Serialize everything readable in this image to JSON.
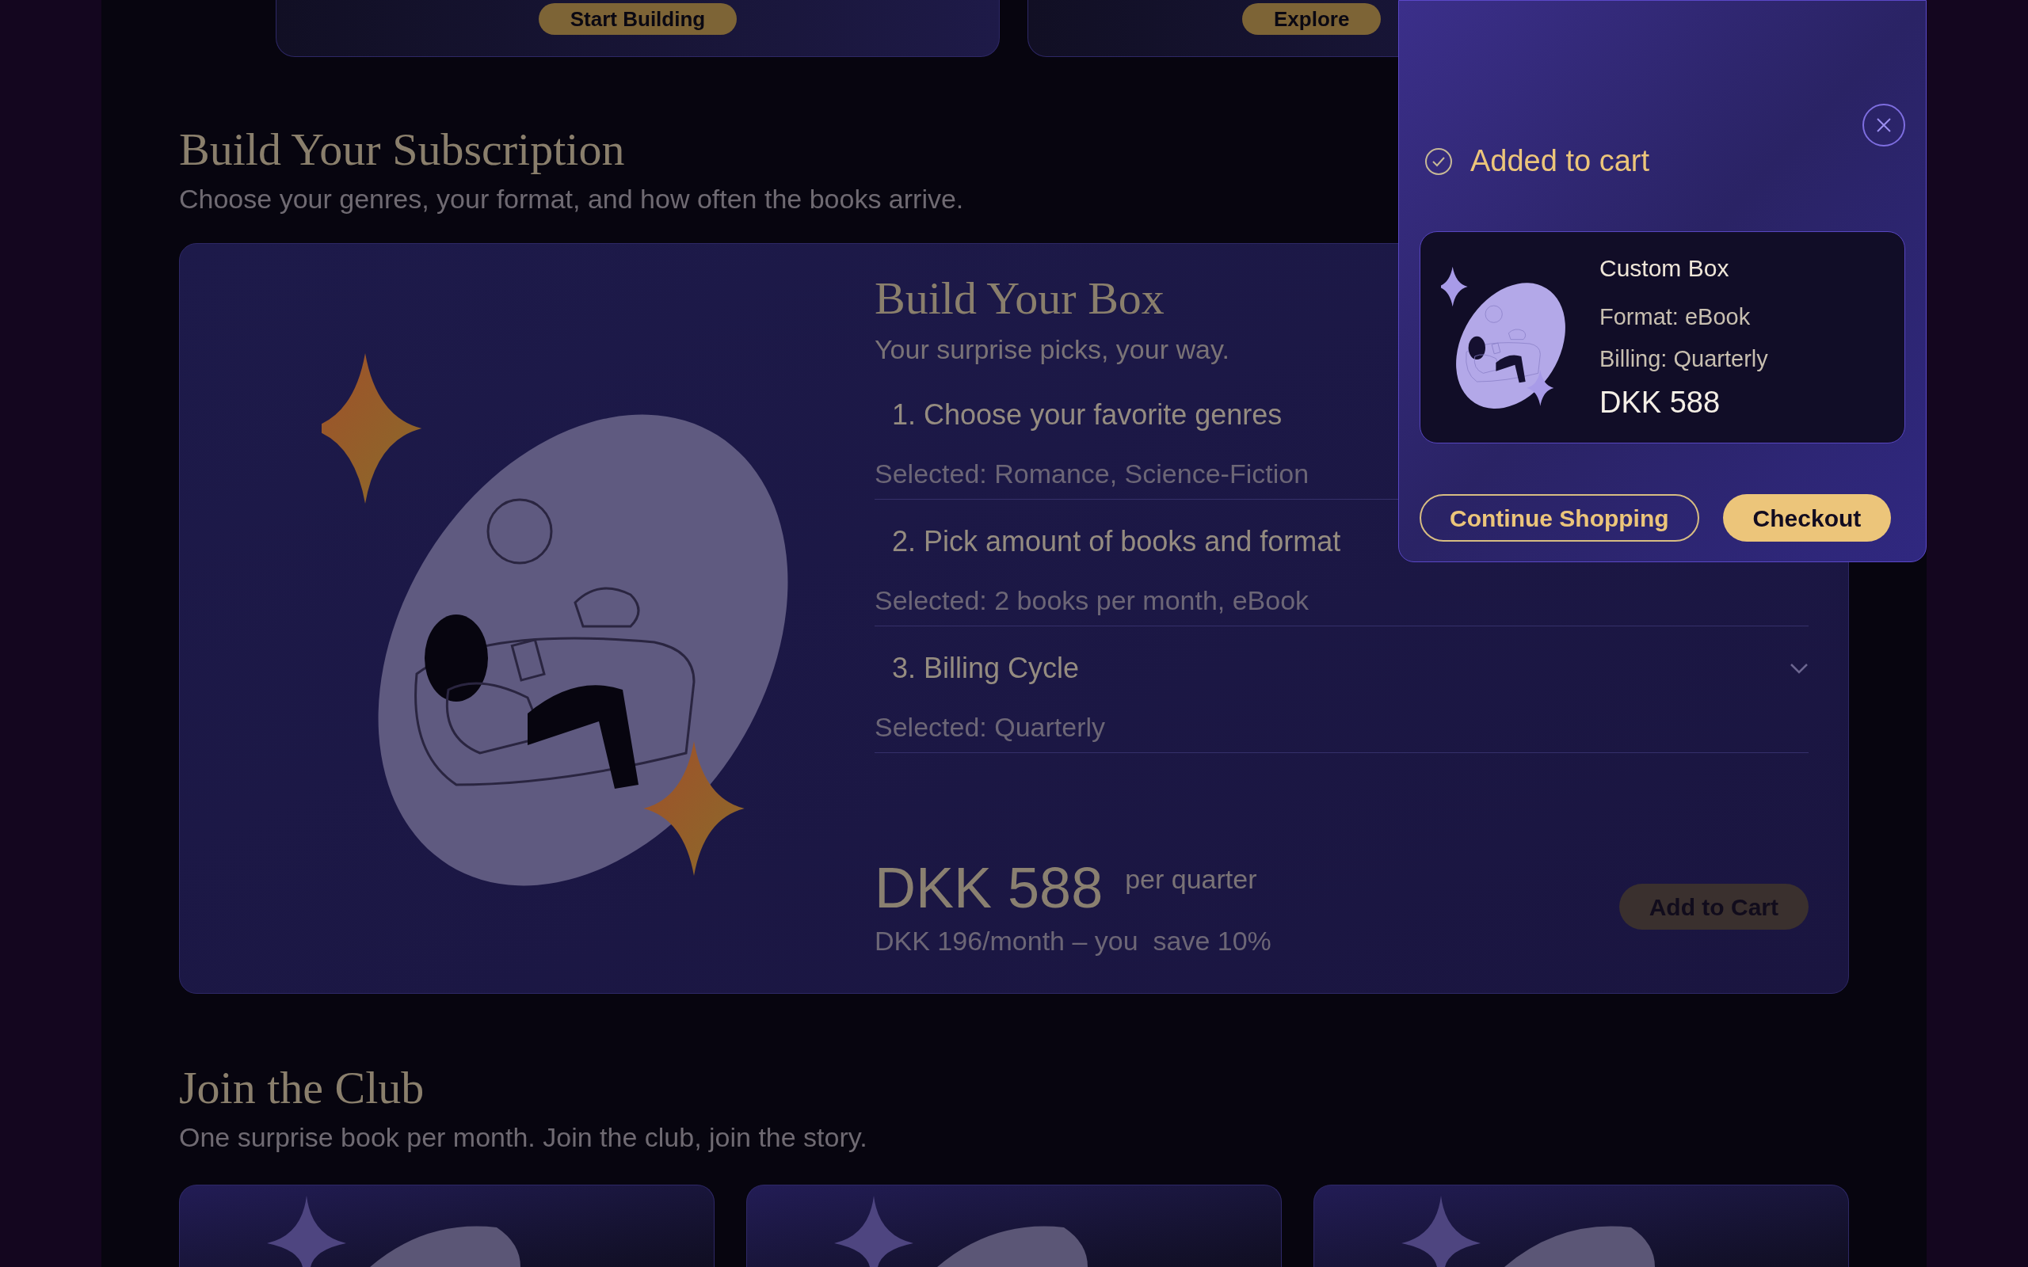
{
  "top_cards": [
    {
      "button": "Start Building"
    },
    {
      "button": "Explore"
    }
  ],
  "subscription": {
    "title": "Build Your Subscription",
    "subtitle": "Choose your genres, your format, and how often the books arrive.",
    "box": {
      "title": "Build Your Box",
      "subtitle": "Your surprise picks, your way.",
      "steps": [
        {
          "number": "1.",
          "label": "Choose your favorite genres",
          "selected_text": "Selected: Romance, Science-Fiction",
          "kind": "plain"
        },
        {
          "number": "2.",
          "label": "Pick amount of books and format",
          "selected_text": "Selected: 2 books per month, eBook",
          "kind": "plain"
        },
        {
          "number": "3.",
          "label": "Billing Cycle",
          "selected_text": "Selected: Quarterly",
          "kind": "dropdown"
        }
      ],
      "price": "DKK 588",
      "period": "per quarter",
      "note": "DKK 196/month – you  save 10%",
      "button": "Add to Cart"
    }
  },
  "club": {
    "title": "Join the Club",
    "subtitle": "One surprise book per month. Join the club, join the story.",
    "cards": [
      {
        "kind": "illustration"
      },
      {
        "kind": "illustration"
      },
      {
        "kind": "illustration"
      }
    ]
  },
  "toast": {
    "message": "Added to cart",
    "item": {
      "name": "Custom Box",
      "format": "Format: eBook",
      "billing": "Billing: Quarterly",
      "price": "DKK 588"
    },
    "buttons": [
      {
        "label": "Continue Shopping",
        "kind": "outline"
      },
      {
        "label": "Checkout",
        "kind": "primary"
      }
    ]
  }
}
